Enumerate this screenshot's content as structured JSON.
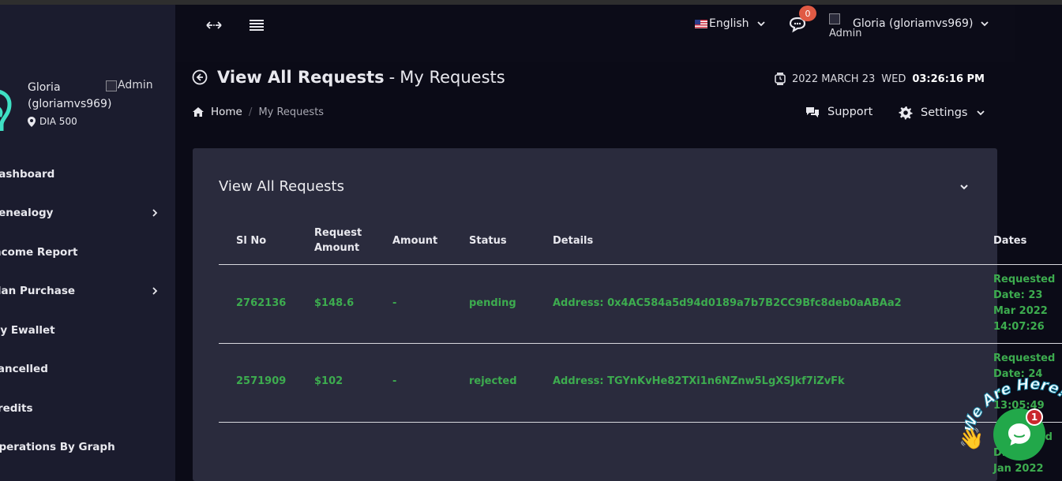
{
  "sidebar": {
    "profile": {
      "name": "Gloria (gloriamvs969)",
      "location": "DIA 500",
      "admin_img_alt": "Admin"
    },
    "items": [
      {
        "label": "Dashboard",
        "has_submenu": false
      },
      {
        "label": "Genealogy",
        "has_submenu": true
      },
      {
        "label": "Income Report",
        "has_submenu": false
      },
      {
        "label": "Plan Purchase",
        "has_submenu": true
      },
      {
        "label": "My Ewallet",
        "has_submenu": false
      },
      {
        "label": "Cancelled",
        "has_submenu": false
      },
      {
        "label": "Credits",
        "has_submenu": false
      },
      {
        "label": "Operations By Graph",
        "has_submenu": false
      }
    ]
  },
  "topbar": {
    "language": "English",
    "notification_count": "0",
    "user_img_alt": "Admin",
    "user_name": "Gloria (gloriamvs969)"
  },
  "page": {
    "title": "View All Requests",
    "title_sep": "-",
    "subtitle": "My Requests",
    "date": "2022 MARCH 23",
    "day": "WED",
    "time": "03:26:16 PM",
    "breadcrumb": {
      "home": "Home",
      "sep": "/",
      "current": "My Requests"
    },
    "support_label": "Support",
    "settings_label": "Settings"
  },
  "card": {
    "title": "View All Requests",
    "columns": {
      "sl_no": "Sl No",
      "request_amount": "Request Amount",
      "amount": "Amount",
      "status": "Status",
      "details": "Details",
      "dates": "Dates"
    },
    "rows": [
      {
        "sl_no": "2762136",
        "request_amount": "$148.6",
        "amount": "-",
        "status": "pending",
        "details": "Address: 0x4AC584a5d94d0189a7b7B2CC9Bfc8deb0aABAa2",
        "dates": "Requested Date: 23 Mar 2022 14:07:26"
      },
      {
        "sl_no": "2571909",
        "request_amount": "$102",
        "amount": "-",
        "status": "rejected",
        "details": "Address: TGYnKvHe82TXi1n6NZnw5LgXSJkf7iZvFk",
        "dates": "Requested Date: 24 ... 13:05:49"
      },
      {
        "dates_fragment_1": "...ed",
        "dates_fragment_2": "D...",
        "dates_fragment_3": "Jan 2022"
      }
    ]
  },
  "chat_widget": {
    "banner": "We Are Here!",
    "badge": "1"
  },
  "colors": {
    "accent_green": "#3dac4f",
    "card_bg": "#2a2b3d",
    "sidebar_bg": "#1b1c2e",
    "badge_orange": "#e05a44",
    "chat_green": "#22a84a"
  }
}
